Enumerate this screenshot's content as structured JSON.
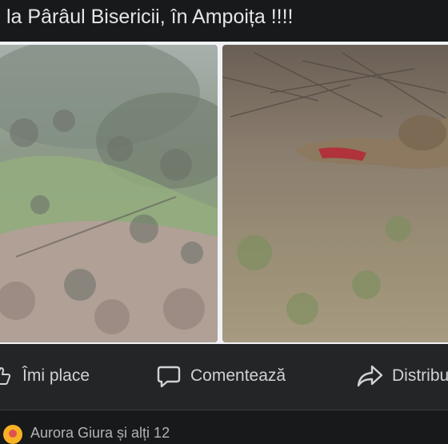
{
  "post": {
    "caption": "la Pârâul Bisericii, în Ampoița !!!!"
  },
  "photos": [
    {
      "description_name": "hillside-photo"
    },
    {
      "description_name": "animal-carcass-photo"
    }
  ],
  "actions": {
    "like_label": "Îmi place",
    "comment_label": "Comentează",
    "share_label": "Distribuie"
  },
  "reactions": {
    "summary": "Aurora Giura și alți 12"
  },
  "colors": {
    "background": "#18191a",
    "action_bar": "#242526",
    "text": "#e4e6eb",
    "muted_text": "#b0b3b8"
  }
}
